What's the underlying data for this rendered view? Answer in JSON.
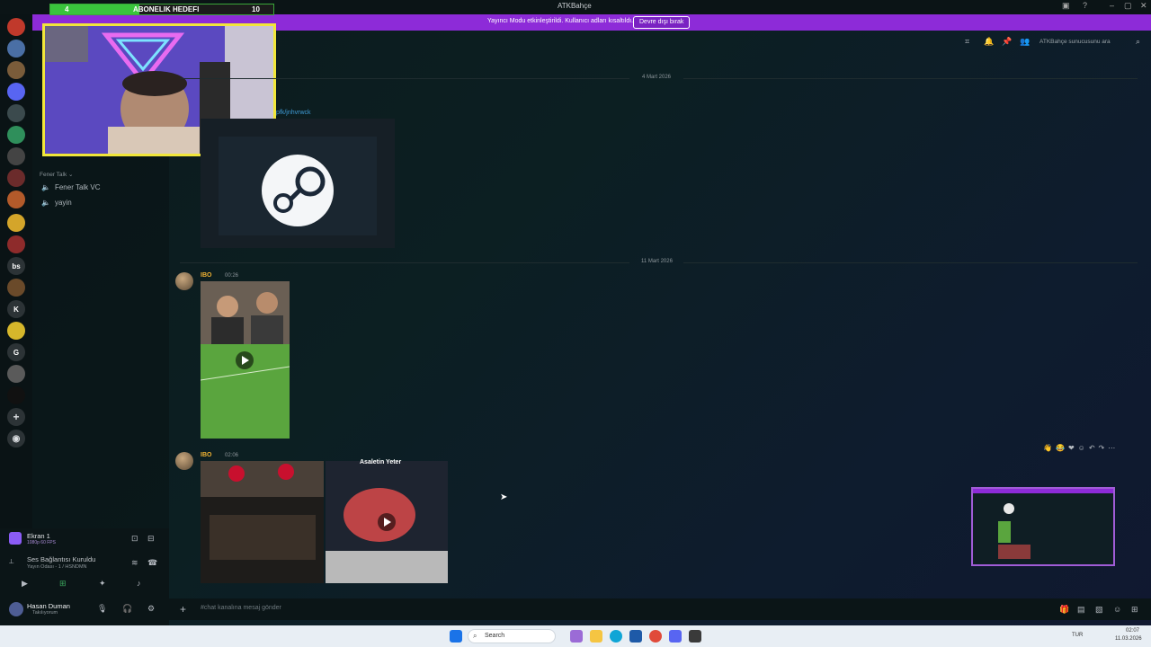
{
  "window": {
    "title": "ATKBahçe"
  },
  "banner": {
    "text": "Yayıncı Modu etkinleştirildi. Kullanıcı adları kısaltıldı.",
    "button": "Devre dışı bırak"
  },
  "goal": {
    "left": "4",
    "label": "ABONELIK HEDEFI",
    "right": "10",
    "progress": 0.4
  },
  "header": {
    "search_placeholder": "ATKBahçe sunucusunu ara"
  },
  "rail": {
    "labels": [
      "bs",
      "K",
      "G"
    ]
  },
  "sidebar": {
    "category": "Fener Talk ⌄",
    "channels": [
      "Fener Talk VC",
      "yayin"
    ]
  },
  "messages": {
    "date1": "4 Mart 2026",
    "link_fragment": "pfk/jnhvrwck",
    "date2": "11 Mart 2026",
    "msg1": {
      "user": "IBO",
      "time": "00:26"
    },
    "msg2": {
      "user": "IBO",
      "time": "02:06",
      "video_caption": "Asaletin Yeter"
    }
  },
  "stream": {
    "title": "Ekran 1",
    "quality": "1080p 60 FPS",
    "voice_status": "Ses Bağlantısı Kuruldu",
    "voice_location": "Yayın Odası - 1 / HSNDMN"
  },
  "user": {
    "name": "Hasan Duman",
    "status": "Takılıyorum"
  },
  "composer": {
    "placeholder": "#chat kanalına mesaj gönder"
  },
  "taskbar": {
    "search": "Search",
    "lang": "TUR",
    "time": "02:07",
    "date": "11.03.2026"
  }
}
